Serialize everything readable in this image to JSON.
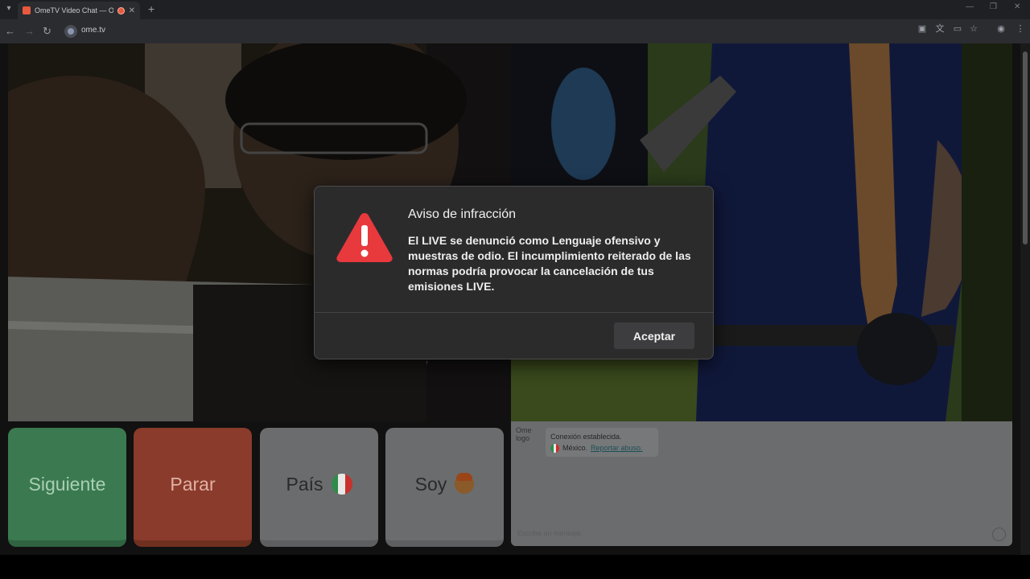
{
  "browser": {
    "tab_title": "OmeTV Video Chat — Ome",
    "tab_close": "✕",
    "new_tab": "+",
    "url": "ome.tv",
    "icons": [
      "back-icon",
      "forward-icon",
      "reload-icon",
      "extensions-icon",
      "translate-icon",
      "cast-icon",
      "bookmark-icon",
      "profile-icon",
      "menu-icon"
    ]
  },
  "controls": {
    "next_label": "Siguiente",
    "stop_label": "Parar",
    "country_label": "País",
    "gender_label": "Soy"
  },
  "chat": {
    "logo_alt": "Ome logo",
    "status_line": "Conexión establecida.",
    "country": "México.",
    "report_link": "Reportar abuso.",
    "placeholder": "Escribe un mensaje"
  },
  "dialog": {
    "title": "Aviso de infracción",
    "body": "El LIVE se denunció como Lenguaje ofensivo y muestras de odio. El incumplimiento reiterado de las normas podría provocar la cancelación de tus emisiones LIVE.",
    "accept_label": "Aceptar"
  },
  "colors": {
    "warning_red": "#e8393d",
    "mexico_green": "#2e8b4a",
    "mexico_red": "#c8312c"
  }
}
